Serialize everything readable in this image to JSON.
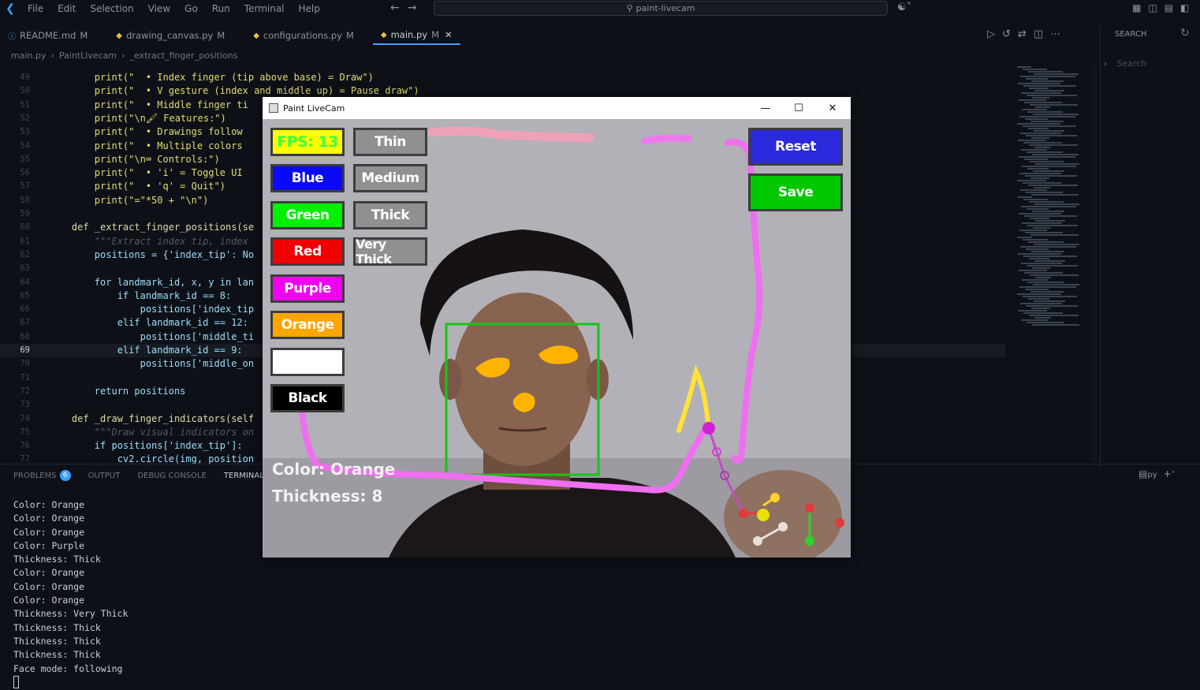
{
  "app": {
    "menu": [
      "File",
      "Edit",
      "Selection",
      "View",
      "Go",
      "Run",
      "Terminal",
      "Help"
    ],
    "command_center": "paint-livecam"
  },
  "tabs": [
    {
      "label": "README.md",
      "mod": "M",
      "icon": "info-icon"
    },
    {
      "label": "drawing_canvas.py",
      "mod": "M",
      "icon": "python-icon"
    },
    {
      "label": "configurations.py",
      "mod": "M",
      "icon": "python-icon"
    },
    {
      "label": "main.py",
      "mod": "M",
      "icon": "python-icon",
      "active": true
    }
  ],
  "breadcrumb": [
    "main.py",
    "PaintLivecam",
    "_extract_finger_positions"
  ],
  "code_lines": [
    {
      "num": "49",
      "text": "        print(\"  • Index finger (tip above base) = Draw\")"
    },
    {
      "num": "50",
      "text": "        print(\"  • V gesture (index and middle up) = Pause draw\")"
    },
    {
      "num": "51",
      "text": "        print(\"  • Middle finger ti"
    },
    {
      "num": "52",
      "text": "        print(\"\\n🖌 Features:\")"
    },
    {
      "num": "53",
      "text": "        print(\"  • Drawings follow"
    },
    {
      "num": "54",
      "text": "        print(\"  • Multiple colors"
    },
    {
      "num": "55",
      "text": "        print(\"\\n⌨ Controls:\")"
    },
    {
      "num": "56",
      "text": "        print(\"  • 'i' = Toggle UI"
    },
    {
      "num": "57",
      "text": "        print(\"  • 'q' = Quit\")"
    },
    {
      "num": "58",
      "text": "        print(\"=\"*50 + \"\\n\")"
    },
    {
      "num": "59",
      "text": ""
    },
    {
      "num": "60",
      "text": "    def _extract_finger_positions(se"
    },
    {
      "num": "61",
      "text": "        \"\"\"Extract index tip, index"
    },
    {
      "num": "62",
      "text": "        positions = {'index_tip': No"
    },
    {
      "num": "63",
      "text": ""
    },
    {
      "num": "64",
      "text": "        for landmark_id, x, y in lan"
    },
    {
      "num": "65",
      "text": "            if landmark_id == 8:"
    },
    {
      "num": "66",
      "text": "                positions['index_tip"
    },
    {
      "num": "67",
      "text": "            elif landmark_id == 12:"
    },
    {
      "num": "68",
      "text": "                positions['middle_ti"
    },
    {
      "num": "69",
      "text": "            elif landmark_id == 9:"
    },
    {
      "num": "70",
      "text": "                positions['middle_on"
    },
    {
      "num": "71",
      "text": ""
    },
    {
      "num": "72",
      "text": "        return positions"
    },
    {
      "num": "73",
      "text": ""
    },
    {
      "num": "74",
      "text": "    def _draw_finger_indicators(self"
    },
    {
      "num": "75",
      "text": "        \"\"\"Draw visual indicators on"
    },
    {
      "num": "76",
      "text": "        if positions['index_tip']:"
    },
    {
      "num": "77",
      "text": "            cv2.circle(img, position"
    }
  ],
  "side_panel": {
    "title": "SEARCH",
    "placeholder": "Search"
  },
  "panel": {
    "tabs": [
      "PROBLEMS",
      "OUTPUT",
      "DEBUG CONSOLE",
      "TERMINAL"
    ],
    "problems_count": "6",
    "right_label": "py",
    "terminal_lines": [
      "Color: Orange",
      "Color: Orange",
      "Color: Orange",
      "Color: Purple",
      "Thickness: Thick",
      "Color: Orange",
      "Color: Orange",
      "Color: Orange",
      "Thickness: Very Thick",
      "Thickness: Thick",
      "Thickness: Thick",
      "Thickness: Thick",
      "Face mode: following"
    ]
  },
  "paint": {
    "title": "Paint LiveCam",
    "fps": "FPS: 13",
    "color_buttons": [
      {
        "label": "Blue",
        "bg": "#0a0af5",
        "fg": "#ffffff"
      },
      {
        "label": "Green",
        "bg": "#00f000",
        "fg": "#ffffff"
      },
      {
        "label": "Red",
        "bg": "#f00000",
        "fg": "#ffffff"
      },
      {
        "label": "Purple",
        "bg": "#f000f0",
        "fg": "#ffffff"
      },
      {
        "label": "Orange",
        "bg": "#ffa500",
        "fg": "#ffffff"
      },
      {
        "label": "",
        "bg": "#ffffff",
        "fg": "#ffffff"
      },
      {
        "label": "Black",
        "bg": "#000000",
        "fg": "#ffffff"
      }
    ],
    "thickness_buttons": [
      "Thin",
      "Medium",
      "Thick",
      "Very Thick"
    ],
    "reset_label": "Reset",
    "save_label": "Save",
    "status_color": "Color: Orange",
    "status_thickness": "Thickness: 8"
  }
}
